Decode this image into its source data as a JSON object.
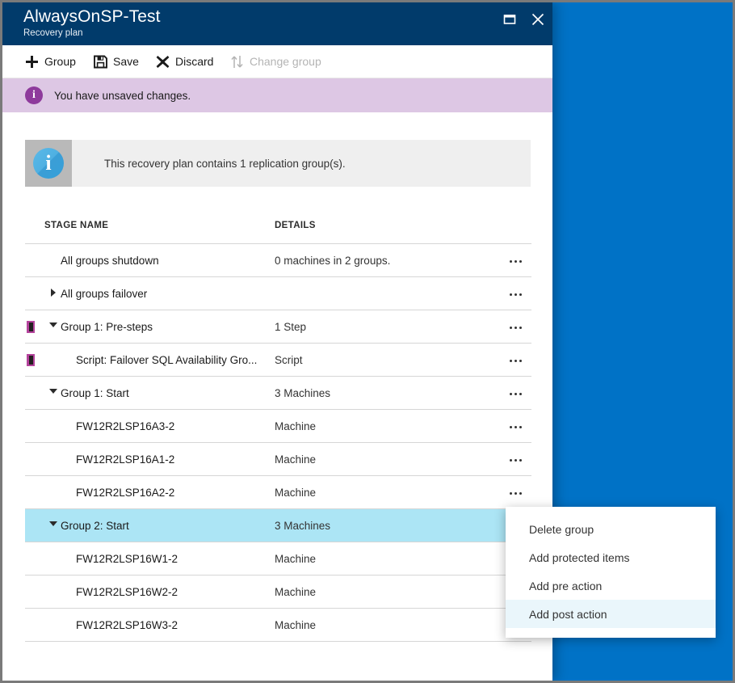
{
  "window": {
    "title": "AlwaysOnSP-Test",
    "subtitle": "Recovery plan",
    "maximize_icon": "maximize-icon",
    "close_icon": "close-icon"
  },
  "commandbar": {
    "items": [
      {
        "label": "Group",
        "icon": "plus-icon",
        "disabled": false
      },
      {
        "label": "Save",
        "icon": "save-disk-icon",
        "disabled": false
      },
      {
        "label": "Discard",
        "icon": "x-cross-icon",
        "disabled": false
      },
      {
        "label": "Change group",
        "icon": "sort-arrows-icon",
        "disabled": true
      }
    ]
  },
  "notification": {
    "icon": "info-circle-icon",
    "text": "You have unsaved changes.",
    "background": "#ddc7e4",
    "icon_color": "#8e3a9c"
  },
  "infobox": {
    "icon": "info-circle-icon",
    "text": "This recovery plan contains 1 replication group(s).",
    "background": "#efefef",
    "icon_background": "#b9b9b9",
    "icon_color": "#4fb0e2"
  },
  "grid": {
    "columns": [
      "STAGE NAME",
      "DETAILS"
    ],
    "rows": [
      {
        "name": "All groups shutdown",
        "detail": "0 machines in 2 groups.",
        "indent": 0,
        "toggle": "none",
        "marker": false,
        "selected": false
      },
      {
        "name": "All groups failover",
        "detail": "",
        "indent": 0,
        "toggle": "right",
        "marker": false,
        "selected": false
      },
      {
        "name": "Group 1: Pre-steps",
        "detail": "1 Step",
        "indent": 0,
        "toggle": "down",
        "marker": true,
        "selected": false
      },
      {
        "name": "Script: Failover SQL Availability Gro...",
        "detail": "Script",
        "indent": 1,
        "toggle": "none",
        "marker": true,
        "selected": false
      },
      {
        "name": "Group 1: Start",
        "detail": "3 Machines",
        "indent": 0,
        "toggle": "down",
        "marker": false,
        "selected": false
      },
      {
        "name": "FW12R2LSP16A3-2",
        "detail": "Machine",
        "indent": 1,
        "toggle": "none",
        "marker": false,
        "selected": false
      },
      {
        "name": "FW12R2LSP16A1-2",
        "detail": "Machine",
        "indent": 1,
        "toggle": "none",
        "marker": false,
        "selected": false
      },
      {
        "name": "FW12R2LSP16A2-2",
        "detail": "Machine",
        "indent": 1,
        "toggle": "none",
        "marker": false,
        "selected": false
      },
      {
        "name": "Group 2: Start",
        "detail": "3 Machines",
        "indent": 0,
        "toggle": "down",
        "marker": false,
        "selected": true
      },
      {
        "name": "FW12R2LSP16W1-2",
        "detail": "Machine",
        "indent": 1,
        "toggle": "none",
        "marker": false,
        "selected": false
      },
      {
        "name": "FW12R2LSP16W2-2",
        "detail": "Machine",
        "indent": 1,
        "toggle": "none",
        "marker": false,
        "selected": false
      },
      {
        "name": "FW12R2LSP16W3-2",
        "detail": "Machine",
        "indent": 1,
        "toggle": "none",
        "marker": false,
        "selected": false
      }
    ],
    "row_action_icon": "ellipsis-icon"
  },
  "context_menu": {
    "items": [
      {
        "label": "Delete group",
        "highlighted": false
      },
      {
        "label": "Add protected items",
        "highlighted": false
      },
      {
        "label": "Add pre action",
        "highlighted": false
      },
      {
        "label": "Add post action",
        "highlighted": true
      }
    ],
    "highlight_color": "#eaf6fb"
  },
  "theme": {
    "title_bar": "#013b6b",
    "portal_background": "#0072c6",
    "selected_row": "#ace5f5",
    "marker_purple": "#b4439c"
  }
}
